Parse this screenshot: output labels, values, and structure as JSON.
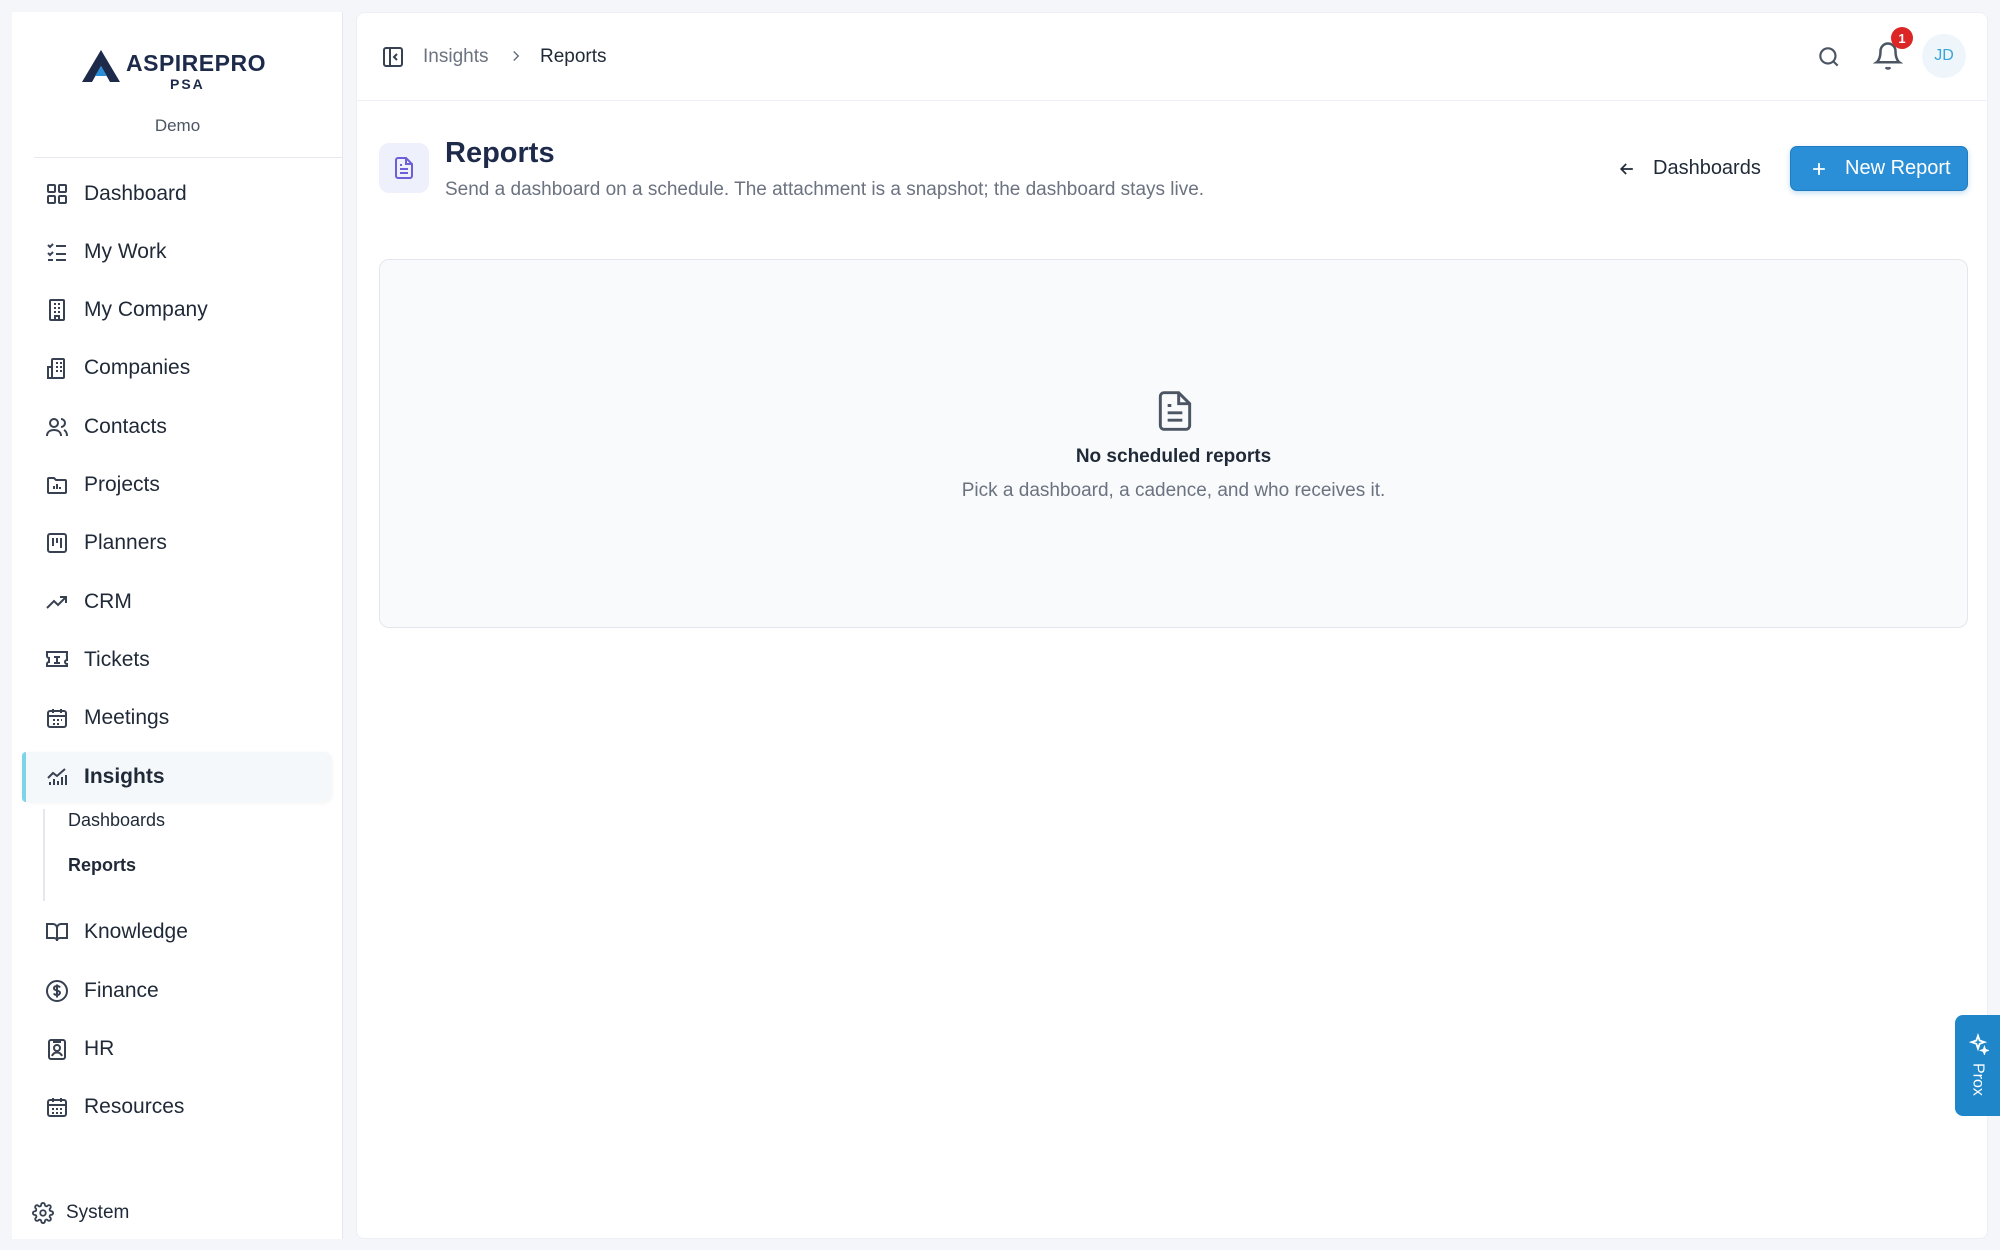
{
  "brand": {
    "name": "ASPIREPRO",
    "sub": "PSA"
  },
  "workspace": "Demo",
  "sidebar": {
    "items": [
      {
        "label": "Dashboard",
        "icon": "grid-icon"
      },
      {
        "label": "My Work",
        "icon": "checklist-icon"
      },
      {
        "label": "My Company",
        "icon": "building-icon"
      },
      {
        "label": "Companies",
        "icon": "buildings-icon"
      },
      {
        "label": "Contacts",
        "icon": "users-icon"
      },
      {
        "label": "Projects",
        "icon": "folder-chart-icon"
      },
      {
        "label": "Planners",
        "icon": "kanban-icon"
      },
      {
        "label": "CRM",
        "icon": "trending-up-icon"
      },
      {
        "label": "Tickets",
        "icon": "ticket-icon"
      },
      {
        "label": "Meetings",
        "icon": "calendar-icon"
      },
      {
        "label": "Insights",
        "icon": "bar-chart-icon",
        "active": true
      },
      {
        "label": "Knowledge",
        "icon": "book-open-icon"
      },
      {
        "label": "Finance",
        "icon": "dollar-circle-icon"
      },
      {
        "label": "HR",
        "icon": "id-badge-icon"
      },
      {
        "label": "Resources",
        "icon": "calendar-grid-icon"
      }
    ],
    "insights_sub": [
      {
        "label": "Dashboards"
      },
      {
        "label": "Reports",
        "current": true
      }
    ],
    "system_label": "System"
  },
  "topbar": {
    "breadcrumb": [
      "Insights",
      "Reports"
    ],
    "notifications_count": "1",
    "avatar_initials": "JD"
  },
  "page": {
    "title": "Reports",
    "subtitle": "Send a dashboard on a schedule. The attachment is a snapshot; the dashboard stays live.",
    "dashboards_link": "Dashboards",
    "new_report_label": "New Report"
  },
  "empty_state": {
    "title": "No scheduled reports",
    "subtitle": "Pick a dashboard, a cadence, and who receives it."
  },
  "assistant_tab": {
    "label": "Prox"
  },
  "colors": {
    "accent": "#2a8fd6",
    "badge": "#dc2626",
    "active_bar": "#7dd3e8"
  }
}
